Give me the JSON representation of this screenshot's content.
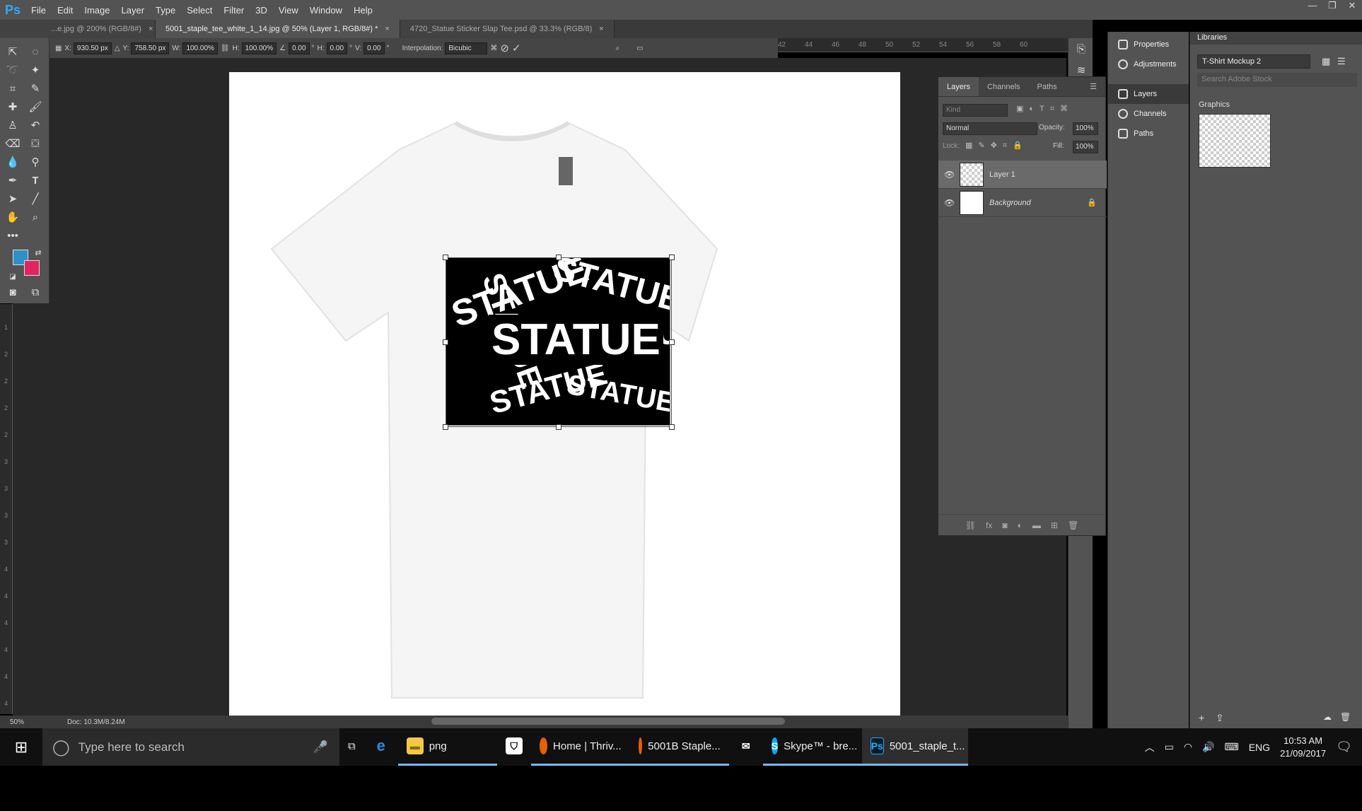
{
  "app": {
    "logo": "Ps"
  },
  "menu": [
    "File",
    "Edit",
    "Image",
    "Layer",
    "Type",
    "Select",
    "Filter",
    "3D",
    "View",
    "Window",
    "Help"
  ],
  "window_controls": [
    "—",
    "❐",
    "✕"
  ],
  "tabs": [
    {
      "label": "...e.jpg @ 200% (RGB/8#)",
      "active": false
    },
    {
      "label": "5001_staple_tee_white_1_14.jpg @ 50% (Layer 1, RGB/8#) *",
      "active": true
    },
    {
      "label": "4720_Statue Sticker Slap Tee.psd @ 33.3% (RGB/8)",
      "active": false
    }
  ],
  "tab_close": "×",
  "options": {
    "x_label": "X:",
    "x_value": "930.50 px",
    "y_label": "Y:",
    "y_value": "758.50 px",
    "w_label": "W:",
    "w_value": "100.00%",
    "h_label": "H:",
    "h_value": "100.00%",
    "angle_value": "0.00",
    "deg": "°",
    "hskew_label": "H:",
    "hskew_value": "0.00",
    "vskew_label": "V:",
    "vskew_value": "0.00",
    "interp_label": "Interpolation:",
    "interp_value": "Bicubic"
  },
  "ruler_top": [
    "42",
    "44",
    "46",
    "48",
    "50",
    "52",
    "54",
    "56",
    "58",
    "60"
  ],
  "ruler_left": [
    "1",
    "2",
    "2",
    "2",
    "2",
    "3",
    "3",
    "3",
    "3",
    "4",
    "4",
    "4",
    "4",
    "4",
    "4"
  ],
  "colors": {
    "foreground": "#2f8fc9",
    "background": "#e4245f"
  },
  "artwork": {
    "text": "STATUE"
  },
  "status": {
    "zoom": "50%",
    "doc": "Doc: 10.3M/8.24M"
  },
  "side_panels": [
    "Properties",
    "Adjustments",
    "Layers",
    "Channels",
    "Paths"
  ],
  "layers_panel": {
    "tabs": [
      "Layers",
      "Channels",
      "Paths"
    ],
    "kind_placeholder": "Kind",
    "blend": "Normal",
    "opacity_label": "Opacity:",
    "opacity": "100%",
    "lock_label": "Lock:",
    "fill_label": "Fill:",
    "fill": "100%",
    "layers": [
      {
        "name": "Layer 1",
        "selected": true
      },
      {
        "name": "Background",
        "selected": false
      }
    ]
  },
  "libraries": {
    "title": "Libraries",
    "library": "T-Shirt Mockup 2",
    "search_placeholder": "Search Adobe Stock",
    "section": "Graphics"
  },
  "taskbar": {
    "search": "Type here to search",
    "apps": [
      {
        "label": "png"
      },
      {
        "label": "Home | Thriv..."
      },
      {
        "label": "5001B Staple..."
      },
      {
        "label": "Skype™ - bre..."
      },
      {
        "label": "5001_staple_t..."
      }
    ],
    "lang": "ENG",
    "time": "10:53 AM",
    "date": "21/09/2017"
  }
}
